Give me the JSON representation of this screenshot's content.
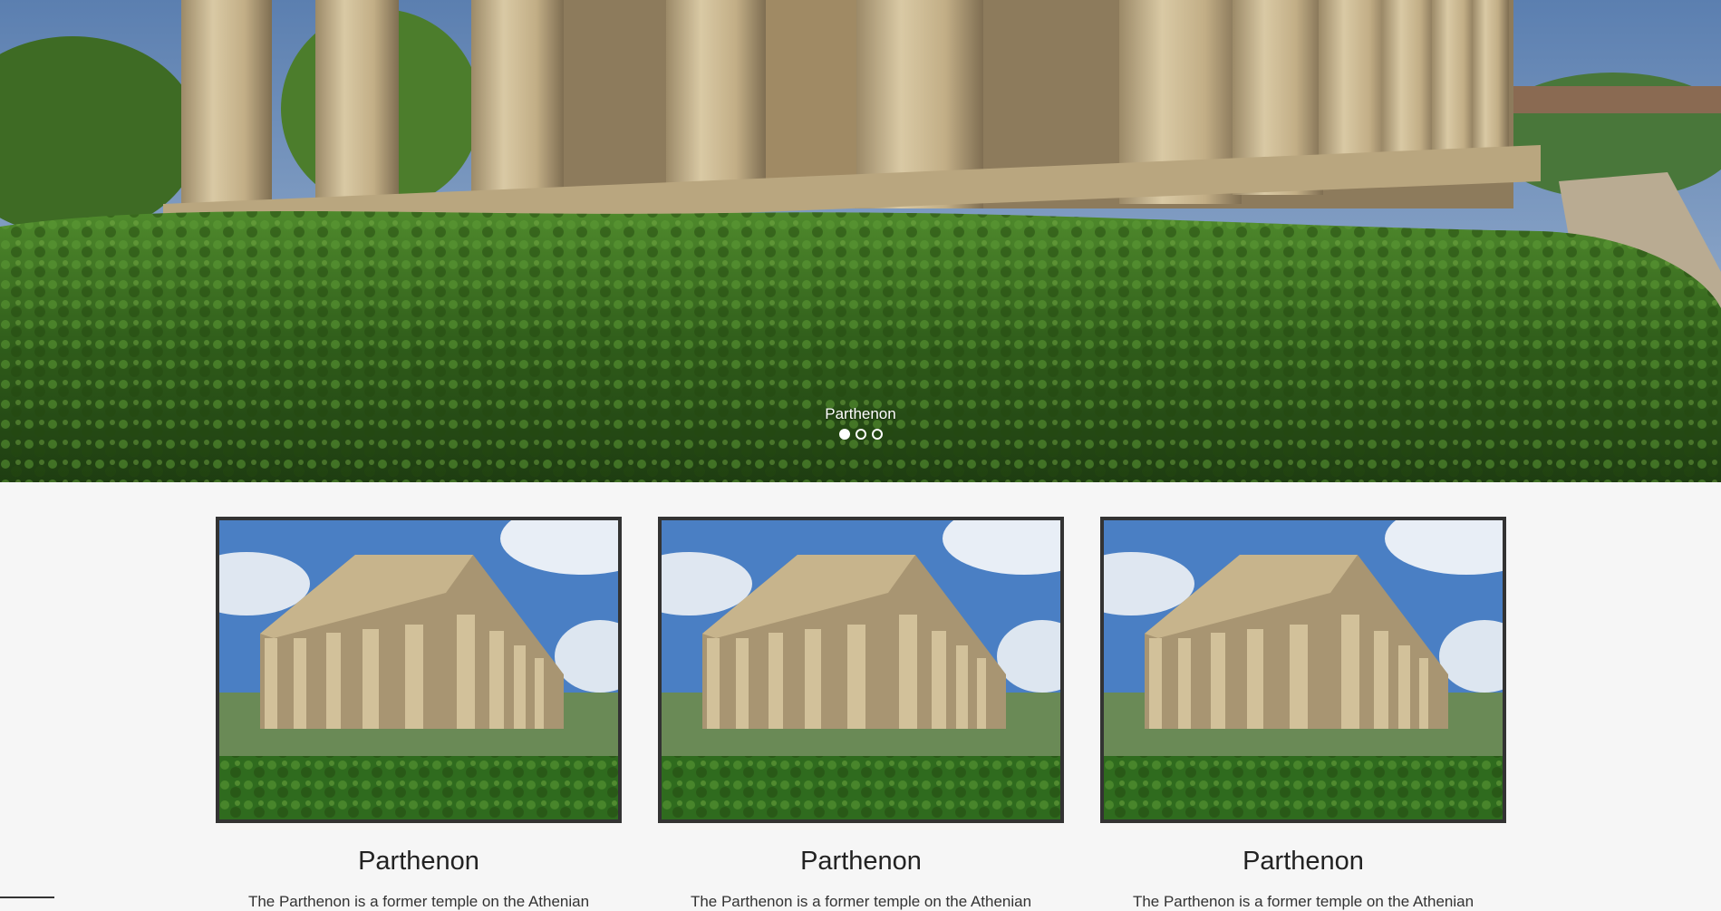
{
  "hero": {
    "caption": "Parthenon",
    "slides": [
      "slide-1",
      "slide-2",
      "slide-3"
    ],
    "active_slide": 1
  },
  "cards": [
    {
      "title": "Parthenon",
      "description": "The Parthenon is a former temple on the Athenian"
    },
    {
      "title": "Parthenon",
      "description": "The Parthenon is a former temple on the Athenian"
    },
    {
      "title": "Parthenon",
      "description": "The Parthenon is a former temple on the Athenian"
    }
  ],
  "colors": {
    "page_background": "#f6f6f6",
    "card_border": "#333333",
    "title_text": "#222222",
    "sky": "#4a7fc4",
    "foliage": "#3d6b22",
    "stone": "#c8b48a"
  }
}
